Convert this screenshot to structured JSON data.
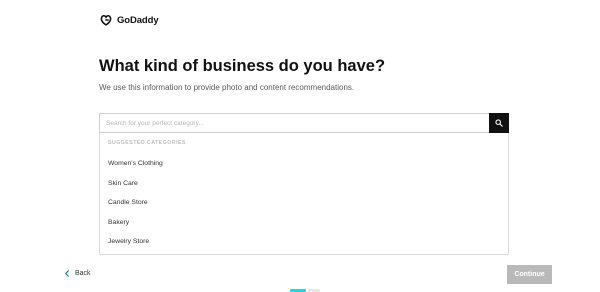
{
  "header": {
    "logo_text": "GoDaddy"
  },
  "main": {
    "title": "What kind of business do you have?",
    "subtitle": "We use this information to provide photo and content recommendations."
  },
  "search": {
    "placeholder": "Search for your perfect category...",
    "value": ""
  },
  "dropdown": {
    "header": "SUGGESTED CATEGORIES",
    "items": [
      "Women's Clothing",
      "Skin Care",
      "Candle Store",
      "Bakery",
      "Jewelry Store"
    ]
  },
  "footer": {
    "back_label": "Back",
    "continue_label": "Continue"
  },
  "progress": {
    "current_step": 1
  },
  "colors": {
    "accent": "#1bdbdb",
    "continue_disabled": "#b9b9b9",
    "search_button": "#111111"
  },
  "icons": {
    "logo": "godaddy-logo-icon",
    "search": "search-icon",
    "back": "chevron-left-icon"
  }
}
